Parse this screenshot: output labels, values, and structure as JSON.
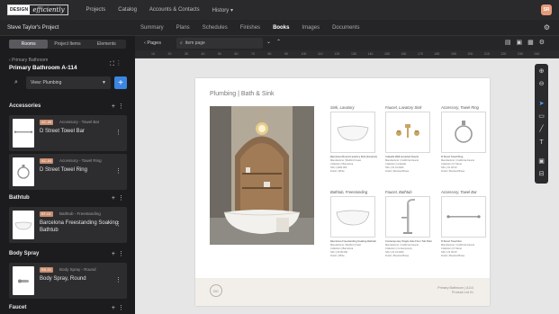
{
  "app": {
    "logo_box": "DESIGN",
    "logo_script": "efficiently",
    "nav": [
      "Projects",
      "Catalog",
      "Accounts & Contacts",
      "History ▾"
    ],
    "avatar": "SR"
  },
  "project": {
    "title": "Steve Taylor's Project",
    "tabs": [
      "Summary",
      "Plans",
      "Schedules",
      "Finishes",
      "Books",
      "Images",
      "Documents"
    ],
    "active_tab": "Books"
  },
  "sidebar": {
    "seg_tabs": [
      "Rooms",
      "Project Items",
      "Elements"
    ],
    "breadcrumb": "‹ Primary Bathroom",
    "room_title": "Primary Bathroom A-114",
    "view_select": "View: Plumbing",
    "sections": [
      {
        "title": "Accessories",
        "items": [
          {
            "tag": "AC-05",
            "category": "Accessory - Towel Bar",
            "name": "D Street Towel Bar"
          },
          {
            "tag": "AC-04",
            "category": "Accessory - Towel Ring",
            "name": "D Street Towel Ring"
          }
        ]
      },
      {
        "title": "Bathtub",
        "items": [
          {
            "tag": "BT-01",
            "category": "Bathtub - Freestanding",
            "name": "Barcelona Freestanding Soaking Bathtub"
          }
        ]
      },
      {
        "title": "Body Spray",
        "items": [
          {
            "tag": "BS-01",
            "category": "Body Spray - Round",
            "name": "Body Spray, Round"
          }
        ]
      },
      {
        "title": "Faucet",
        "items": []
      }
    ]
  },
  "toolbar": {
    "pages": "‹ Pages",
    "search_placeholder": "item page"
  },
  "ruler": [
    "10",
    "20",
    "30",
    "40",
    "50",
    "60",
    "70",
    "80",
    "90",
    "100",
    "110",
    "120",
    "130",
    "140",
    "150",
    "160",
    "170",
    "180",
    "190",
    "200",
    "210",
    "220",
    "230",
    "240"
  ],
  "page": {
    "title": "Plumbing | Bath & Sink",
    "products": [
      {
        "title": "Sink, Lavatory",
        "name": "Barcelona Round Lavatory Sink (Ceramic)",
        "lines": [
          "Manufacturer | Bedford Coast",
          "Collection | Barcelona",
          "SKU | 0000 000",
          "Finish | White"
        ]
      },
      {
        "title": "Faucet, Lavatory Sink",
        "name": "Arabella Wall-mounted Faucet",
        "lines": [
          "Manufacturer | California Faucet",
          "Collection | Arabella",
          "SKU | 01 01 0000",
          "Finish | Brushed Brass"
        ]
      },
      {
        "title": "Accessory, Towel Ring",
        "name": "D Street Towel Ring",
        "lines": [
          "Manufacturer | California Faucet",
          "Collection | D Street",
          "SKU | 01 00 00",
          "Finish | Brushed Brass"
        ]
      },
      {
        "title": "Bathtub, Freestanding",
        "name": "Barcelona Freestanding Soaking Bathtub",
        "lines": [
          "Manufacturer | Bedford Coast",
          "Collection | Barcelona",
          "SKU | 00 00 000",
          "Finish | White"
        ]
      },
      {
        "title": "Faucet, Bathtub",
        "name": "Contemporary Single Hole Floor Tub Filler",
        "lines": [
          "Manufacturer | California Faucet",
          "Collection | Contemporary",
          "SKU | 01 01 0000",
          "Finish | Brushed Brass"
        ]
      },
      {
        "title": "Accessory, Towel Bar",
        "name": "D Street Towel Bar",
        "lines": [
          "Manufacturer | California Faucet",
          "Collection | D Street",
          "SKU | 01 00 00",
          "Finish | Brushed Brass"
        ]
      }
    ],
    "footer_badge": "DC",
    "footer_line1": "Primary Bathroom | A114",
    "footer_line2": "Product List 01"
  }
}
